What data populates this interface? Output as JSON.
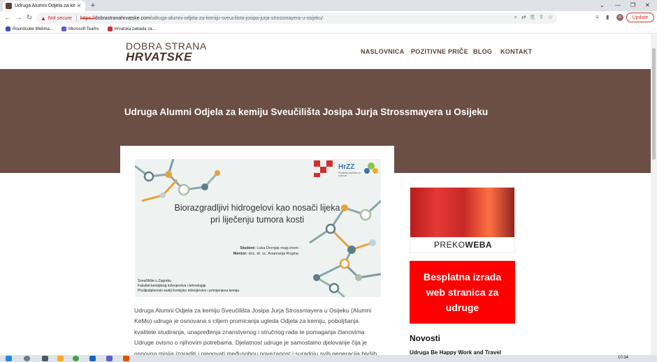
{
  "browser": {
    "tab_title": "Udruga Alumni Odjela za kemiju",
    "not_secure": "Not secure",
    "url_scheme": "https://",
    "url_host": "dobrastranahrvatske.com",
    "url_path": "/udruga-alumni-odjela-za-kemiju-sveucilista-josipa-jurja-strossmayera-u-osijeku/",
    "update_label": "Update",
    "avatar_letter": "A",
    "bookmarks": [
      {
        "label": "Roundcube Webma...",
        "color": "#3f51b5"
      },
      {
        "label": "Microsoft Teams",
        "color": "#5b5fc7"
      },
      {
        "label": "Hrvatska zaklada za...",
        "color": "#d32f2f"
      }
    ]
  },
  "site": {
    "logo_line1": "DOBRA STRANA",
    "logo_line2": "HRVATSKE",
    "nav": [
      "NASLOVNICA",
      "POZITIVNE PRIČE",
      "BLOG",
      "KONTAKT"
    ]
  },
  "hero": {
    "title": "Udruga Alumni Odjela za kemiju Sveučilišta Josipa Jurja Strossmayera u Osijeku"
  },
  "featured_image": {
    "title": "Biorazgradljivi hidrogelovi kao nosači lijeka pri liječenju tumora kosti",
    "student_label": "Student:",
    "student": "Luka Dornjak mag.chem",
    "mentor_label": "Mentor:",
    "mentor": "doc. dr. sc. Anamarija Rogina",
    "footer_lines": [
      "Sveučilište u Zagrebu",
      "Fakultet kemijskog inženjerstva i tehnologije",
      "Poslijediplomski studij Kemijsko inženjerstvo i primijenjena kemija"
    ],
    "hrzz": "HrZZ",
    "hrzz_sub": "Hrvatska zaklada za znanost"
  },
  "article": {
    "text": "Udruga Alumni Odjela za kemiju Sveučilišta Josipa Jurja Strossmayera u Osijeku (Alumni KeMo) udruga je osnovana s ciljem promicanja ugleda Odjela za kemiju, poboljšanja kvalitete studiranja, unapređenja znanstvenog i stručnog rada te pomaganja članovima Udruge ovisno o njihovim potrebama. Djelatnost udruge je samostalno djelovanje čija je osnovna misija izgraditi i njegovati međusobnu povezanost i suradnju svih generacija bivših"
  },
  "sidebar": {
    "ad1_part1": "PREKO",
    "ad1_part2": "WEBA",
    "ad2": "Besplatna izrada web stranica za udruge",
    "news_heading": "Novosti",
    "news_item": "Udruga Be Happy Work and Travel"
  },
  "taskbar": {
    "time": "10:34"
  }
}
